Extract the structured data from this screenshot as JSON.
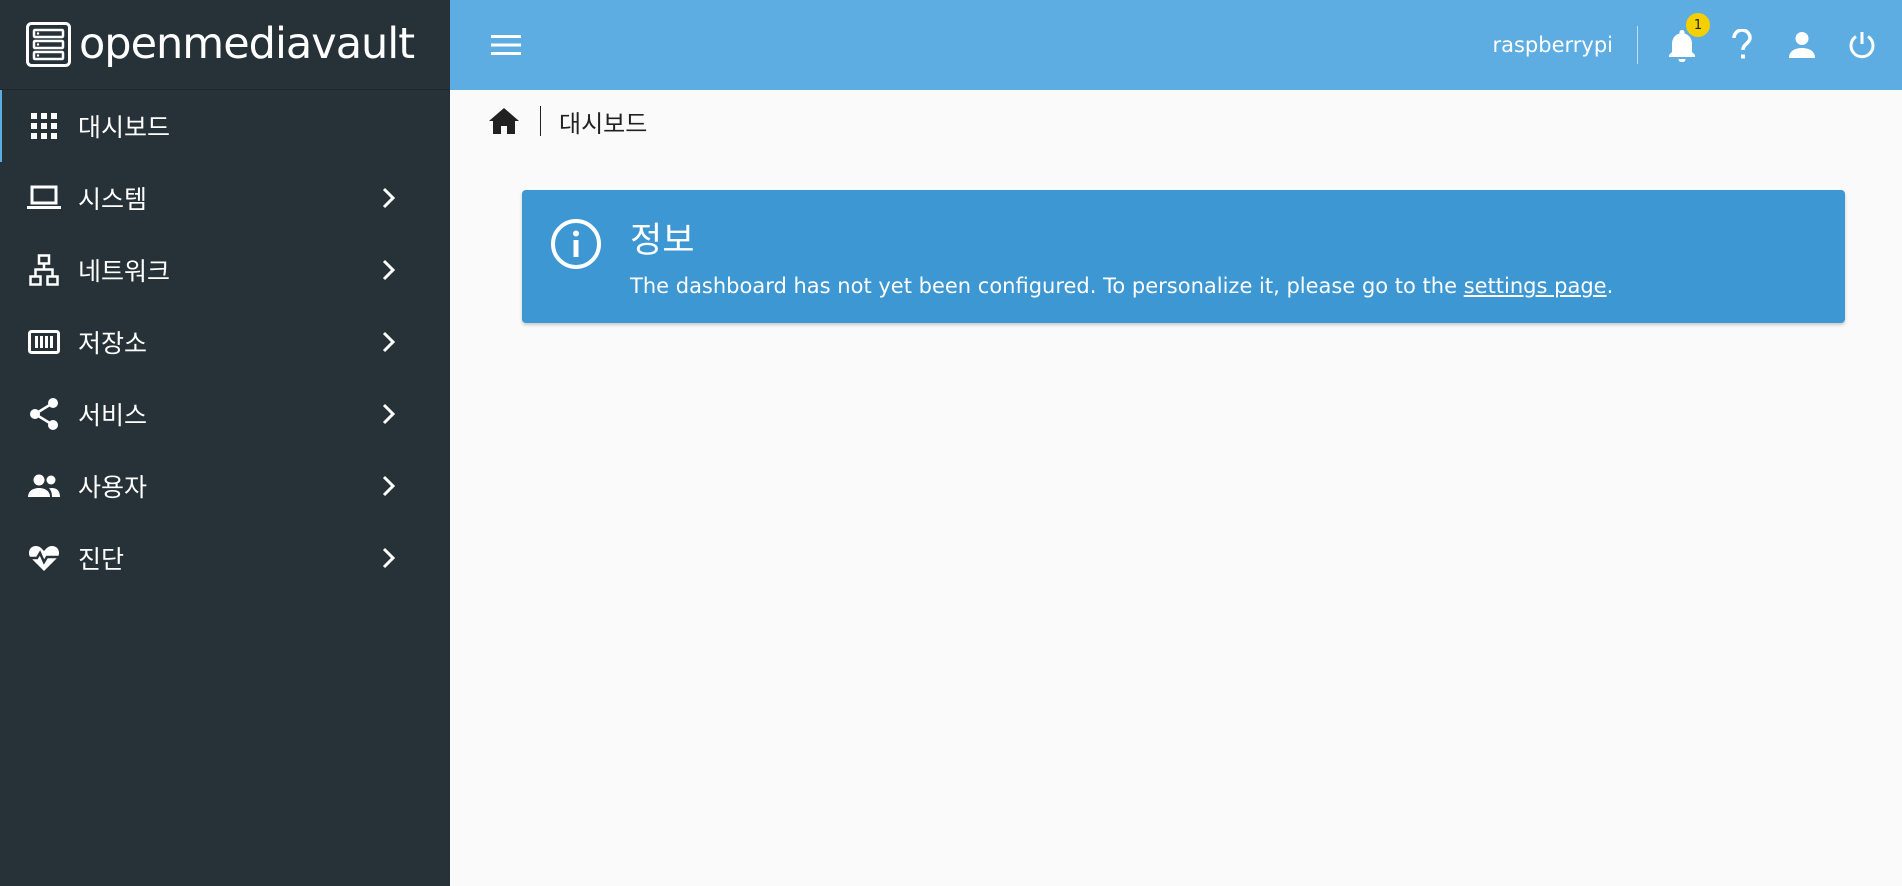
{
  "app": {
    "logo_text": "openmediavault"
  },
  "sidebar": {
    "items": [
      {
        "label": "대시보드",
        "icon": "dashboard-grid-icon",
        "active": true
      },
      {
        "label": "시스템",
        "icon": "laptop-icon"
      },
      {
        "label": "네트워크",
        "icon": "network-icon"
      },
      {
        "label": "저장소",
        "icon": "storage-icon"
      },
      {
        "label": "서비스",
        "icon": "share-icon"
      },
      {
        "label": "사용자",
        "icon": "users-icon"
      },
      {
        "label": "진단",
        "icon": "heart-pulse-icon"
      }
    ]
  },
  "topbar": {
    "hostname": "raspberrypi",
    "notification_count": "1",
    "icons": [
      "menu-icon",
      "bell-icon",
      "help-icon",
      "user-icon",
      "power-icon"
    ]
  },
  "breadcrumb": {
    "current": "대시보드"
  },
  "alert": {
    "title": "정보",
    "message": "The dashboard has not yet been configured. To personalize it, please go to the ",
    "link_text": "settings page",
    "message_end": "."
  },
  "colors": {
    "sidebar_bg": "#263238",
    "topbar_bg": "#5dade2",
    "alert_bg": "#3c97d3",
    "badge_bg": "#f5d000",
    "page_bg": "#fafafa"
  }
}
